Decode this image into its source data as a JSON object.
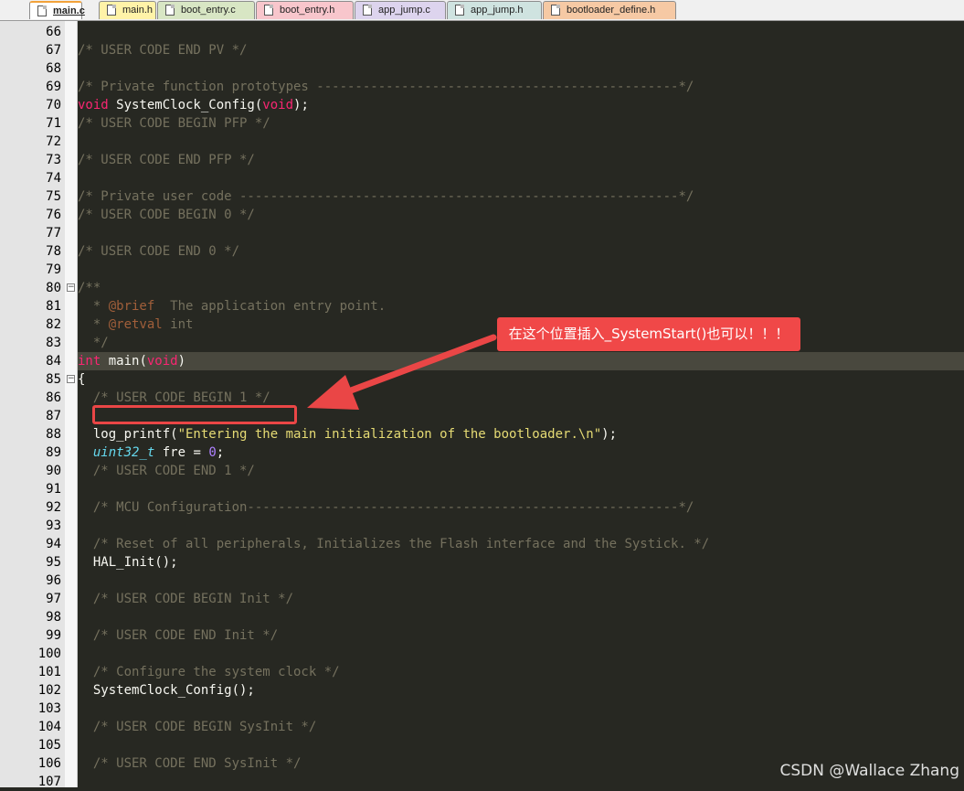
{
  "tabs": [
    {
      "label": "main.c",
      "color": "#ffffff",
      "active": true
    },
    {
      "label": "main.h",
      "color": "#fff3a8",
      "active": false
    },
    {
      "label": "boot_entry.c",
      "color": "#d8e6c4",
      "active": false
    },
    {
      "label": "boot_entry.h",
      "color": "#f8c6cc",
      "active": false
    },
    {
      "label": "app_jump.c",
      "color": "#ddd4ee",
      "active": false
    },
    {
      "label": "app_jump.h",
      "color": "#cfe3e0",
      "active": false
    },
    {
      "label": "bootloader_define.h",
      "color": "#f6c9a4",
      "active": false
    }
  ],
  "editor": {
    "highlight_line": 84,
    "lines": [
      {
        "num": "66",
        "segs": []
      },
      {
        "num": "67",
        "segs": [
          [
            "c",
            "/* USER CODE END PV */"
          ]
        ]
      },
      {
        "num": "68",
        "segs": []
      },
      {
        "num": "69",
        "segs": [
          [
            "c",
            "/* Private function prototypes -----------------------------------------------*/"
          ]
        ]
      },
      {
        "num": "70",
        "segs": [
          [
            "k",
            "void"
          ],
          [
            "p",
            " SystemClock_Config("
          ],
          [
            "k",
            "void"
          ],
          [
            "p",
            ");"
          ]
        ]
      },
      {
        "num": "71",
        "segs": [
          [
            "c",
            "/* USER CODE BEGIN PFP */"
          ]
        ]
      },
      {
        "num": "72",
        "segs": []
      },
      {
        "num": "73",
        "segs": [
          [
            "c",
            "/* USER CODE END PFP */"
          ]
        ]
      },
      {
        "num": "74",
        "segs": []
      },
      {
        "num": "75",
        "segs": [
          [
            "c",
            "/* Private user code ---------------------------------------------------------*/"
          ]
        ]
      },
      {
        "num": "76",
        "segs": [
          [
            "c",
            "/* USER CODE BEGIN 0 */"
          ]
        ]
      },
      {
        "num": "77",
        "segs": []
      },
      {
        "num": "78",
        "segs": [
          [
            "c",
            "/* USER CODE END 0 */"
          ]
        ]
      },
      {
        "num": "79",
        "segs": []
      },
      {
        "num": "80",
        "fold": true,
        "segs": [
          [
            "c",
            "/**"
          ]
        ]
      },
      {
        "num": "81",
        "segs": [
          [
            "ws",
            "  "
          ],
          [
            "c",
            "* "
          ],
          [
            "dk",
            "@brief"
          ],
          [
            "c",
            "  The application entry point."
          ]
        ]
      },
      {
        "num": "82",
        "segs": [
          [
            "ws",
            "  "
          ],
          [
            "c",
            "* "
          ],
          [
            "dk",
            "@retval"
          ],
          [
            "c",
            " int"
          ]
        ]
      },
      {
        "num": "83",
        "segs": [
          [
            "ws",
            "  "
          ],
          [
            "c",
            "*/"
          ]
        ]
      },
      {
        "num": "84",
        "segs": [
          [
            "k",
            "int"
          ],
          [
            "p",
            " main("
          ],
          [
            "k",
            "void"
          ],
          [
            "p",
            ")"
          ]
        ]
      },
      {
        "num": "85",
        "fold": true,
        "segs": [
          [
            "p",
            "{"
          ]
        ]
      },
      {
        "num": "86",
        "segs": [
          [
            "ws",
            "  "
          ],
          [
            "c",
            "/* USER CODE BEGIN 1 */"
          ]
        ]
      },
      {
        "num": "87",
        "segs": [
          [
            "ws",
            "  "
          ]
        ]
      },
      {
        "num": "88",
        "segs": [
          [
            "p",
            "  log_printf("
          ],
          [
            "s",
            "\"Entering the main initialization of the bootloader.\\n\""
          ],
          [
            "p",
            ");"
          ]
        ]
      },
      {
        "num": "89",
        "segs": [
          [
            "p",
            "  "
          ],
          [
            "t",
            "uint32_t"
          ],
          [
            "p",
            " fre = "
          ],
          [
            "n",
            "0"
          ],
          [
            "p",
            ";"
          ]
        ]
      },
      {
        "num": "90",
        "segs": [
          [
            "ws",
            "  "
          ],
          [
            "c",
            "/* USER CODE END 1 */"
          ]
        ]
      },
      {
        "num": "91",
        "segs": []
      },
      {
        "num": "92",
        "segs": [
          [
            "ws",
            "  "
          ],
          [
            "c",
            "/* MCU Configuration--------------------------------------------------------*/"
          ]
        ]
      },
      {
        "num": "93",
        "segs": []
      },
      {
        "num": "94",
        "segs": [
          [
            "ws",
            "  "
          ],
          [
            "c",
            "/* Reset of all peripherals, Initializes the Flash interface and the Systick. */"
          ]
        ]
      },
      {
        "num": "95",
        "segs": [
          [
            "p",
            "  HAL_Init();"
          ]
        ]
      },
      {
        "num": "96",
        "segs": []
      },
      {
        "num": "97",
        "segs": [
          [
            "ws",
            "  "
          ],
          [
            "c",
            "/* USER CODE BEGIN Init */"
          ]
        ]
      },
      {
        "num": "98",
        "segs": []
      },
      {
        "num": "99",
        "segs": [
          [
            "ws",
            "  "
          ],
          [
            "c",
            "/* USER CODE END Init */"
          ]
        ]
      },
      {
        "num": "100",
        "segs": []
      },
      {
        "num": "101",
        "segs": [
          [
            "ws",
            "  "
          ],
          [
            "c",
            "/* Configure the system clock */"
          ]
        ]
      },
      {
        "num": "102",
        "segs": [
          [
            "p",
            "  SystemClock_Config();"
          ]
        ]
      },
      {
        "num": "103",
        "segs": []
      },
      {
        "num": "104",
        "segs": [
          [
            "ws",
            "  "
          ],
          [
            "c",
            "/* USER CODE BEGIN SysInit */"
          ]
        ]
      },
      {
        "num": "105",
        "segs": []
      },
      {
        "num": "106",
        "segs": [
          [
            "ws",
            "  "
          ],
          [
            "c",
            "/* USER CODE END SysInit */"
          ]
        ]
      },
      {
        "num": "107",
        "segs": []
      }
    ]
  },
  "annotation": {
    "callout_text": "在这个位置插入_SystemStart()也可以！！！",
    "color": "#f04848"
  },
  "watermark": "CSDN @Wallace Zhang"
}
